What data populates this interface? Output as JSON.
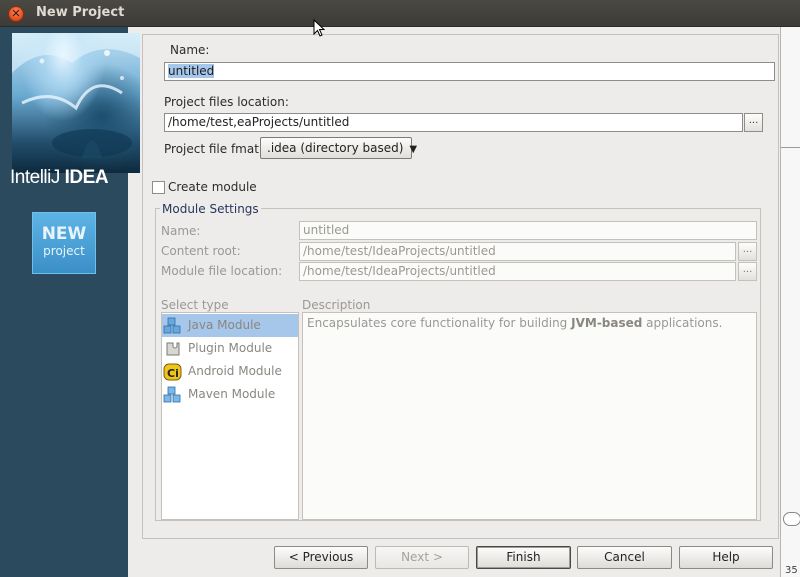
{
  "window": {
    "title": "New Project",
    "close_glyph": "✕"
  },
  "banner": {
    "logo_light": "IntelliJ",
    "logo_bold": "IDEA",
    "badge_line1": "NEW",
    "badge_line2": "project"
  },
  "form": {
    "name_label": "Name:",
    "name_value": "untitled",
    "location_label": "Project files location:",
    "location_value": "/home/test,eaProjects/untitled",
    "format_label": "Project file fmat:",
    "format_value": ".idea (directory based)",
    "browse_label": "...",
    "create_module_label": "Create module",
    "create_module_checked": false
  },
  "module_settings": {
    "title": "Module Settings",
    "name_label": "Name:",
    "name_value": "untitled",
    "content_root_label": "Content root:",
    "content_root_value": "/home/test/IdeaProjects/untitled",
    "module_file_label": "Module file location:",
    "module_file_value": "/home/test/IdeaProjects/untitled",
    "select_type_label": "Select type",
    "description_label": "Description",
    "types": [
      {
        "label": "Java Module",
        "icon": "java-module-icon",
        "selected": true
      },
      {
        "label": "Plugin Module",
        "icon": "plugin-module-icon",
        "selected": false
      },
      {
        "label": "Android Module",
        "icon": "android-module-icon",
        "selected": false
      },
      {
        "label": "Maven Module",
        "icon": "maven-module-icon",
        "selected": false
      }
    ],
    "description_prefix": "Encapsulates core functionality for building ",
    "description_bold": "JVM-based",
    "description_suffix": " applications."
  },
  "buttons": {
    "previous": "< Previous",
    "next": "Next >",
    "finish": "Finish",
    "cancel": "Cancel",
    "help": "Help"
  },
  "background_window": {
    "partial_text": "35"
  },
  "colors": {
    "banner_bg": "#2c4a5e",
    "selection": "#a6c6ea",
    "titlebar": "#3c3b37",
    "close_button": "#e25423"
  }
}
